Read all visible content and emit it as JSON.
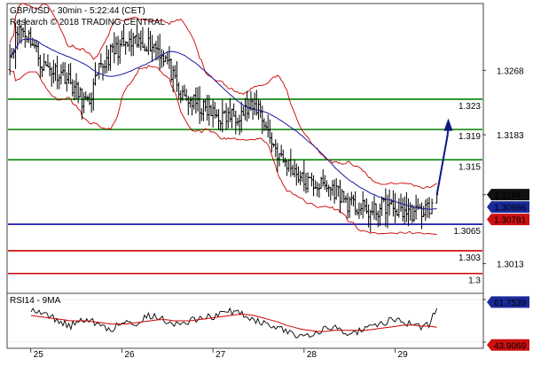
{
  "header": {
    "title": "GBP/USD - 30min - 5:22:44 (CET)",
    "research": "Research © 2018 TRADING CENTRAL"
  },
  "colors": {
    "candle": "#000000",
    "bollinger": "#cc0000",
    "ma": "#1a1aa0",
    "level_green": "#008000",
    "level_blue": "#0a0aa8",
    "level_red": "#cc0000",
    "arrow": "#0a1a80",
    "badge_black": "#111111",
    "badge_blue": "#1a2a9a",
    "badge_red": "#cc1111"
  },
  "chart_data": [
    {
      "type": "candlestick",
      "title": "GBP/USD - 30min",
      "ylim": [
        1.2975,
        1.3355
      ],
      "y_ticks": [
        "1.3268",
        "1.3183",
        "1.3104",
        "1.3013"
      ],
      "x_ticks": [
        "25",
        "26",
        "27",
        "28",
        "29"
      ],
      "price_path": [
        [
          0,
          1.328
        ],
        [
          3,
          1.3325
        ],
        [
          6,
          1.331
        ],
        [
          9,
          1.3275
        ],
        [
          12,
          1.3268
        ],
        [
          15,
          1.3262
        ],
        [
          18,
          1.324
        ],
        [
          21,
          1.3222
        ],
        [
          24,
          1.3266
        ],
        [
          27,
          1.329
        ],
        [
          30,
          1.33
        ],
        [
          33,
          1.3302
        ],
        [
          36,
          1.3305
        ],
        [
          39,
          1.33
        ],
        [
          42,
          1.328
        ],
        [
          45,
          1.3235
        ],
        [
          48,
          1.3228
        ],
        [
          51,
          1.3218
        ],
        [
          54,
          1.321
        ],
        [
          57,
          1.3205
        ],
        [
          60,
          1.321
        ],
        [
          63,
          1.3215
        ],
        [
          66,
          1.322
        ],
        [
          69,
          1.318
        ],
        [
          72,
          1.315
        ],
        [
          75,
          1.314
        ],
        [
          78,
          1.312
        ],
        [
          81,
          1.3118
        ],
        [
          84,
          1.3114
        ],
        [
          87,
          1.3108
        ],
        [
          90,
          1.309
        ],
        [
          93,
          1.3086
        ],
        [
          96,
          1.3079
        ],
        [
          99,
          1.309
        ],
        [
          102,
          1.3085
        ],
        [
          105,
          1.3082
        ],
        [
          108,
          1.308
        ],
        [
          111,
          1.3088
        ]
      ],
      "last_move": [
        [
          111,
          1.3088
        ],
        [
          113,
          1.3104
        ]
      ],
      "levels": [
        {
          "label": "1.323",
          "value": 1.323,
          "color": "#008000"
        },
        {
          "label": "1.319",
          "value": 1.319,
          "color": "#008000"
        },
        {
          "label": "1.315",
          "value": 1.315,
          "color": "#008000"
        },
        {
          "label": "1.3065",
          "value": 1.3065,
          "color": "#0a0aa8"
        },
        {
          "label": "1.303",
          "value": 1.303,
          "color": "#cc0000"
        },
        {
          "label": "1.3",
          "value": 1.3,
          "color": "#cc0000"
        }
      ],
      "price_badges": [
        {
          "label": "1.3104",
          "value": 1.3104,
          "color": "#111111"
        },
        {
          "label": "1.30866",
          "value": 1.30866,
          "color": "#1a2a9a"
        },
        {
          "label": "1.30781",
          "value": 1.30781,
          "color": "#cc1111"
        }
      ],
      "projection": {
        "from": [
          113,
          1.3104
        ],
        "to": [
          116,
          1.32
        ]
      },
      "day_starts": [
        {
          "label": "25",
          "index": 6
        },
        {
          "label": "26",
          "index": 30
        },
        {
          "label": "27",
          "index": 54
        },
        {
          "label": "28",
          "index": 78
        },
        {
          "label": "29",
          "index": 102
        }
      ],
      "index_range": [
        0,
        125
      ]
    },
    {
      "type": "line",
      "title": "RSI14 - 9MA",
      "ylim": [
        25,
        75
      ],
      "y_ticks": [
        "70",
        "30"
      ],
      "series": [
        {
          "values": [
            62,
            58,
            55,
            52,
            48,
            45,
            50,
            53,
            48,
            44,
            42,
            46,
            50,
            47,
            52,
            55,
            53,
            50,
            48,
            46,
            50,
            52,
            55,
            53,
            57,
            59,
            58,
            55,
            52,
            48,
            46,
            43,
            40,
            38,
            36,
            38,
            40,
            42,
            44,
            41,
            38,
            40,
            42,
            45,
            47,
            50,
            52,
            49,
            46,
            44,
            47,
            61.7539
          ]
        },
        {
          "values": [
            55,
            54,
            53,
            52,
            51,
            50,
            50,
            50,
            49,
            48,
            47,
            47,
            47,
            48,
            49,
            50,
            51,
            51,
            50,
            50,
            50,
            51,
            52,
            53,
            54,
            55,
            56,
            56,
            55,
            53,
            51,
            49,
            46,
            44,
            42,
            41,
            40,
            40,
            41,
            41,
            41,
            41,
            41,
            42,
            43,
            44,
            45,
            46,
            46,
            45,
            45,
            43.9069
          ]
        }
      ],
      "badges": [
        {
          "label": "61.7539",
          "value": 61.7539,
          "color": "#1a2a9a"
        },
        {
          "label": "43.9069",
          "value": 43.9069,
          "color": "#cc1111"
        }
      ]
    }
  ]
}
